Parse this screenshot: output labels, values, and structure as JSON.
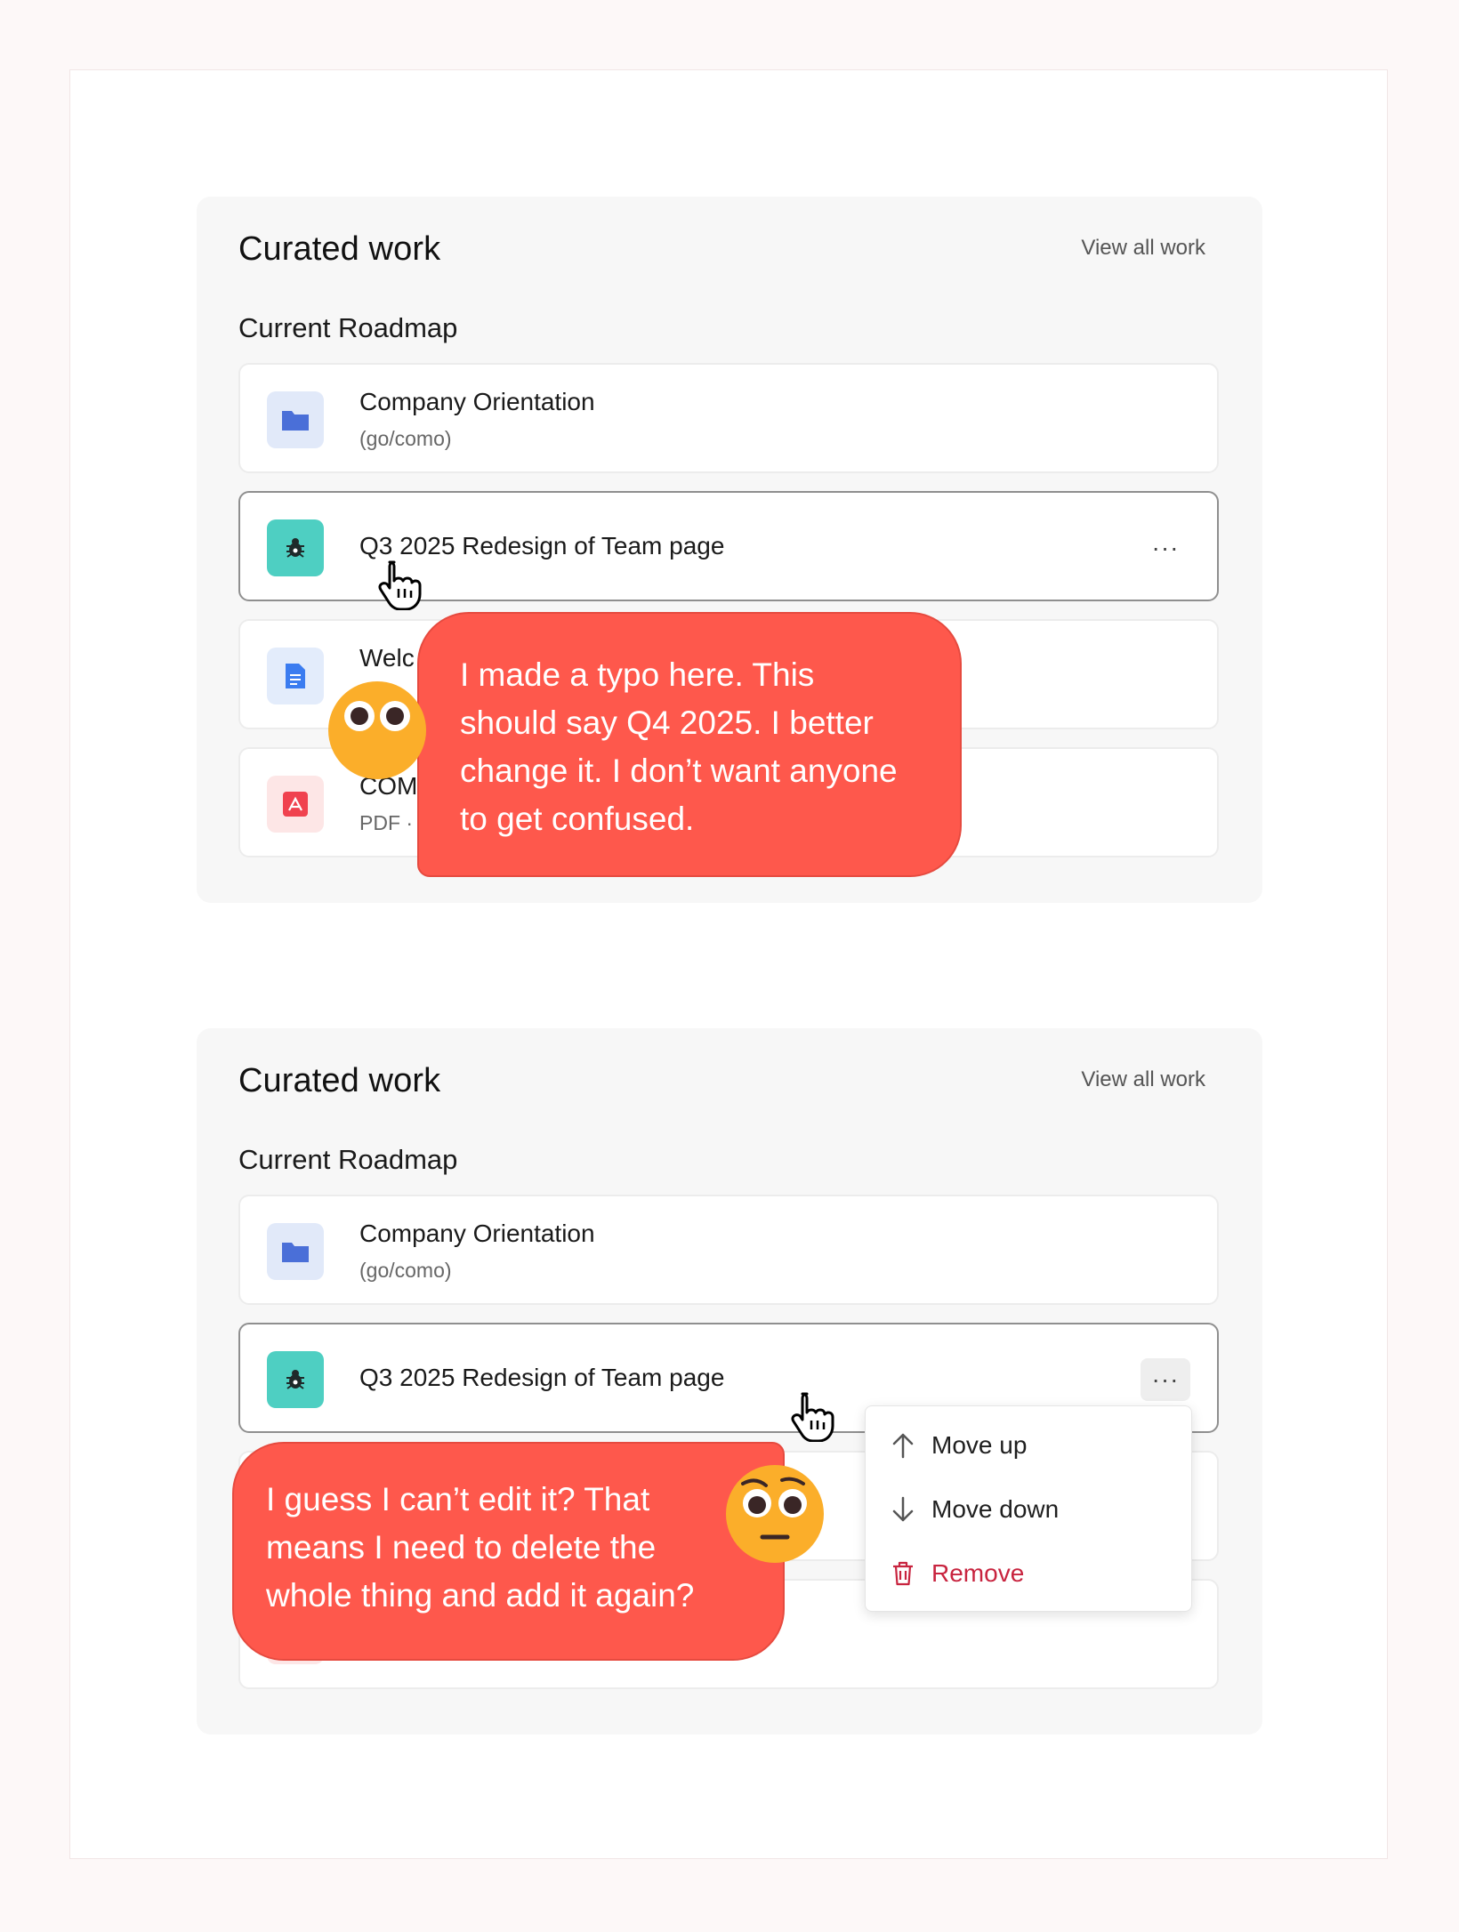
{
  "colors": {
    "accent_bubble": "#fe584c",
    "danger": "#c8243f",
    "folder_blue": "#4a6fd8",
    "teal": "#4ecfc2",
    "pdf_red": "#f0424f",
    "emoji_yellow": "#f9a825"
  },
  "panel1": {
    "title": "Curated work",
    "view_all": "View all work",
    "section": "Current Roadmap",
    "items": [
      {
        "title": "Company Orientation",
        "subtitle": "(go/como)",
        "icon": "folder-icon"
      },
      {
        "title": "Q3 2025 Redesign of Team page",
        "icon": "bug-icon",
        "more": "···"
      },
      {
        "title": "Welc",
        "icon": "google-doc-icon"
      },
      {
        "title": "COM",
        "subtitle": "PDF ·",
        "icon": "pdf-icon"
      }
    ],
    "bubble": "I made a typo here. This should say Q4 2025. I better change it. I don’t want anyone to get confused."
  },
  "panel2": {
    "title": "Curated work",
    "view_all": "View all work",
    "section": "Current Roadmap",
    "items": [
      {
        "title": "Company Orientation",
        "subtitle": "(go/como)",
        "icon": "folder-icon"
      },
      {
        "title": "Q3 2025 Redesign of Team page",
        "icon": "bug-icon",
        "more": "···"
      },
      {
        "title": "",
        "icon": "google-doc-icon"
      },
      {
        "title": "",
        "subtitle": "",
        "icon": "pdf-icon"
      }
    ],
    "menu": {
      "move_up": "Move up",
      "move_down": "Move down",
      "remove": "Remove"
    },
    "bubble": "I guess I can’t edit it? That means I need to delete the whole thing and add it again?"
  }
}
